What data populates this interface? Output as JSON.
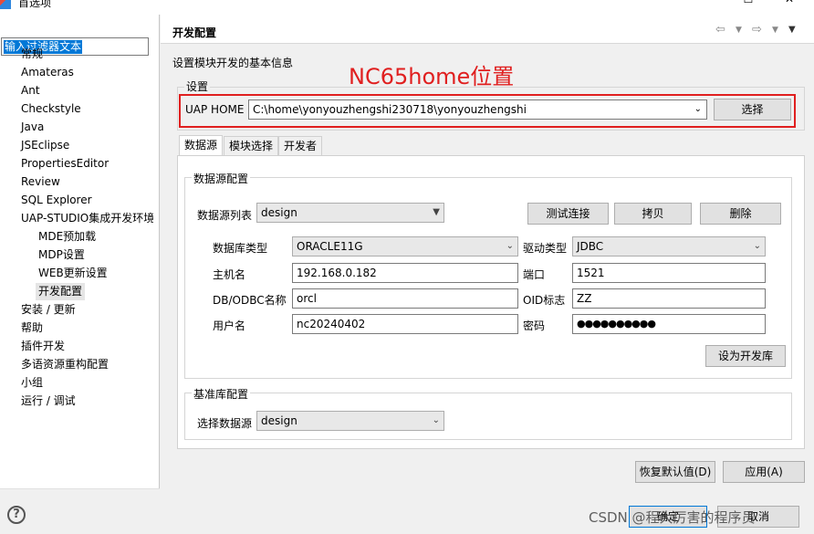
{
  "window": {
    "title": "首选项"
  },
  "filter": {
    "text": "输入过滤器文本"
  },
  "tree": [
    "常规",
    "Amateras",
    "Ant",
    "Checkstyle",
    "Java",
    "JSEclipse",
    "PropertiesEditor",
    "Review",
    "SQL Explorer",
    "UAP-STUDIO集成开发环境",
    "MDE预加载",
    "MDP设置",
    "WEB更新设置",
    "开发配置",
    "安装 / 更新",
    "帮助",
    "插件开发",
    "多语资源重构配置",
    "小组",
    "运行 / 调试"
  ],
  "page": {
    "title": "开发配置",
    "description": "设置模块开发的基本信息",
    "annotation": "NC65home位置",
    "settings_group": "设置",
    "uap_home_label": "UAP HOME",
    "uap_home_value": "C:\\home\\yonyouzhengshi230718\\yonyouzhengshi",
    "choose_button": "选择"
  },
  "tabs": [
    "数据源",
    "模块选择",
    "开发者"
  ],
  "datasource": {
    "group": "数据源配置",
    "list_label": "数据源列表",
    "list_value": "design",
    "test_button": "测试连接",
    "copy_button": "拷贝",
    "delete_button": "删除",
    "db_type_label": "数据库类型",
    "db_type_value": "ORACLE11G",
    "driver_label": "驱动类型",
    "driver_value": "JDBC",
    "host_label": "主机名",
    "host_value": "192.168.0.182",
    "port_label": "端口",
    "port_value": "1521",
    "db_label": "DB/ODBC名称",
    "db_value": "orcl",
    "oid_label": "OID标志",
    "oid_value": "ZZ",
    "user_label": "用户名",
    "user_value": "nc20240402",
    "pwd_label": "密码",
    "pwd_value": "●●●●●●●●●●",
    "set_dev_button": "设为开发库"
  },
  "baseline": {
    "group": "基准库配置",
    "select_label": "选择数据源",
    "select_value": "design"
  },
  "footer": {
    "restore_button": "恢复默认值(D)",
    "apply_button": "应用(A)",
    "ok_button": "确定",
    "cancel_button": "取消",
    "watermark": "CSDN @程大厉害的程序员"
  }
}
